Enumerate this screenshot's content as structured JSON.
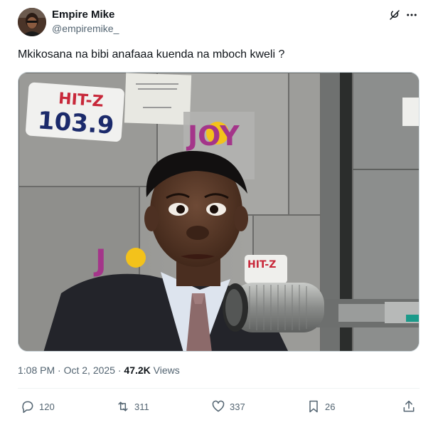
{
  "author": {
    "name": "Empire Mike",
    "handle": "@empiremike_",
    "avatar_icon": "profile-photo"
  },
  "header_icons": [
    "grok-icon",
    "more-icon"
  ],
  "tweet": {
    "text": "Mkikosana na bibi anafaaa kuenda na mboch kweli ?"
  },
  "media": {
    "sign_hitz": "HIT-Z",
    "sign_hitz_freq": "103.9",
    "sign_joy": "JOY",
    "sign_hitz_small": "HIT-Z"
  },
  "meta": {
    "timestamp": "1:08 PM · Oct 2, 2025 · ",
    "views_count": "47.2K",
    "views_label": " Views"
  },
  "actions": {
    "reply_count": "120",
    "retweet_count": "311",
    "like_count": "337",
    "bookmark_count": "26"
  },
  "colors": {
    "text_primary": "#0f1419",
    "text_secondary": "#536471",
    "border": "#cfd9de"
  }
}
